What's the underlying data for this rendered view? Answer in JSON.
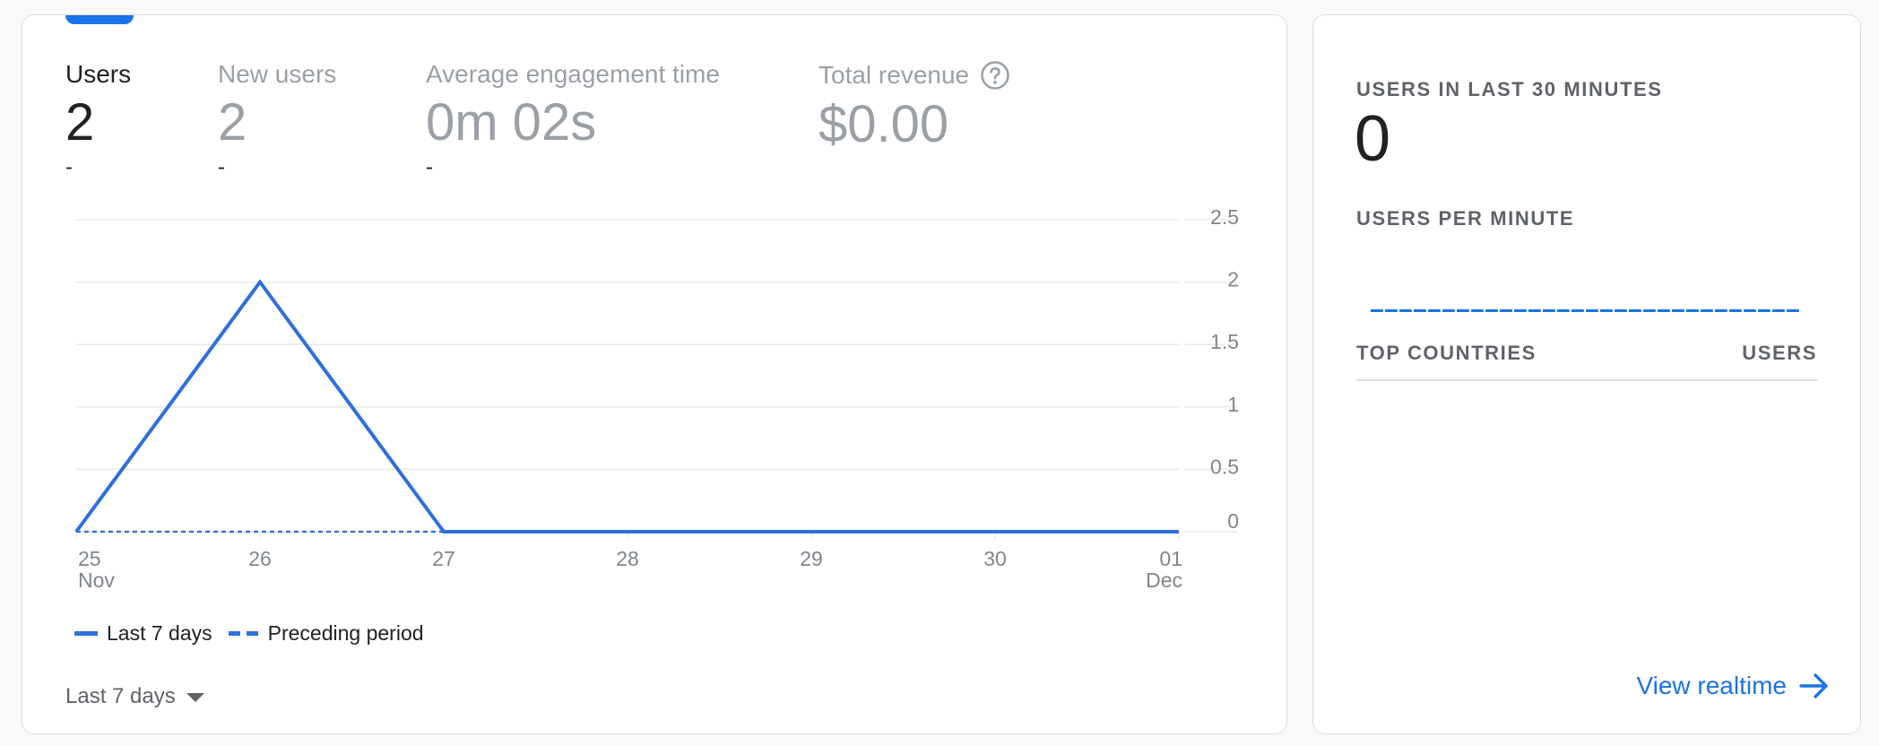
{
  "colors": {
    "accent": "#1a73e8",
    "series_primary": "#2e6fdc",
    "gridline": "#e8eaed",
    "muted_text": "#9aa0a6"
  },
  "metrics": [
    {
      "label": "Users",
      "value": "2",
      "delta": "-",
      "active": true
    },
    {
      "label": "New users",
      "value": "2",
      "delta": "-",
      "active": false
    },
    {
      "label": "Average engagement time",
      "value": "0m 02s",
      "delta": "-",
      "active": false
    },
    {
      "label": "Total revenue",
      "value": "$0.00",
      "delta": "",
      "active": false,
      "icon": "help-circle-icon"
    }
  ],
  "chart_data": {
    "type": "line",
    "x": [
      "25",
      "26",
      "27",
      "28",
      "29",
      "30",
      "01"
    ],
    "x_sublabels": {
      "first": "Nov",
      "last": "Dec"
    },
    "series": [
      {
        "name": "Last 7 days",
        "values": [
          0,
          2,
          0,
          0,
          0,
          0,
          0
        ],
        "style": "solid"
      },
      {
        "name": "Preceding period",
        "values": [
          0,
          0,
          0,
          0,
          0,
          0,
          0
        ],
        "style": "dashed"
      }
    ],
    "y_ticks": [
      "2.5",
      "2",
      "1.5",
      "1",
      "0.5",
      "0"
    ],
    "ylim": [
      0,
      2.5
    ],
    "grid": true,
    "legend_position": "bottom-left"
  },
  "legend": {
    "items": [
      {
        "label": "Last 7 days"
      },
      {
        "label": "Preceding period"
      }
    ]
  },
  "period_selector": {
    "label": "Last 7 days",
    "icon": "caret-down-icon"
  },
  "realtime": {
    "users_heading": "USERS IN LAST 30 MINUTES",
    "users_value": "0",
    "per_minute_heading": "USERS PER MINUTE",
    "top_countries_heading": "TOP COUNTRIES",
    "users_column": "USERS",
    "link_label": "View realtime",
    "link_icon": "arrow-right-icon"
  }
}
